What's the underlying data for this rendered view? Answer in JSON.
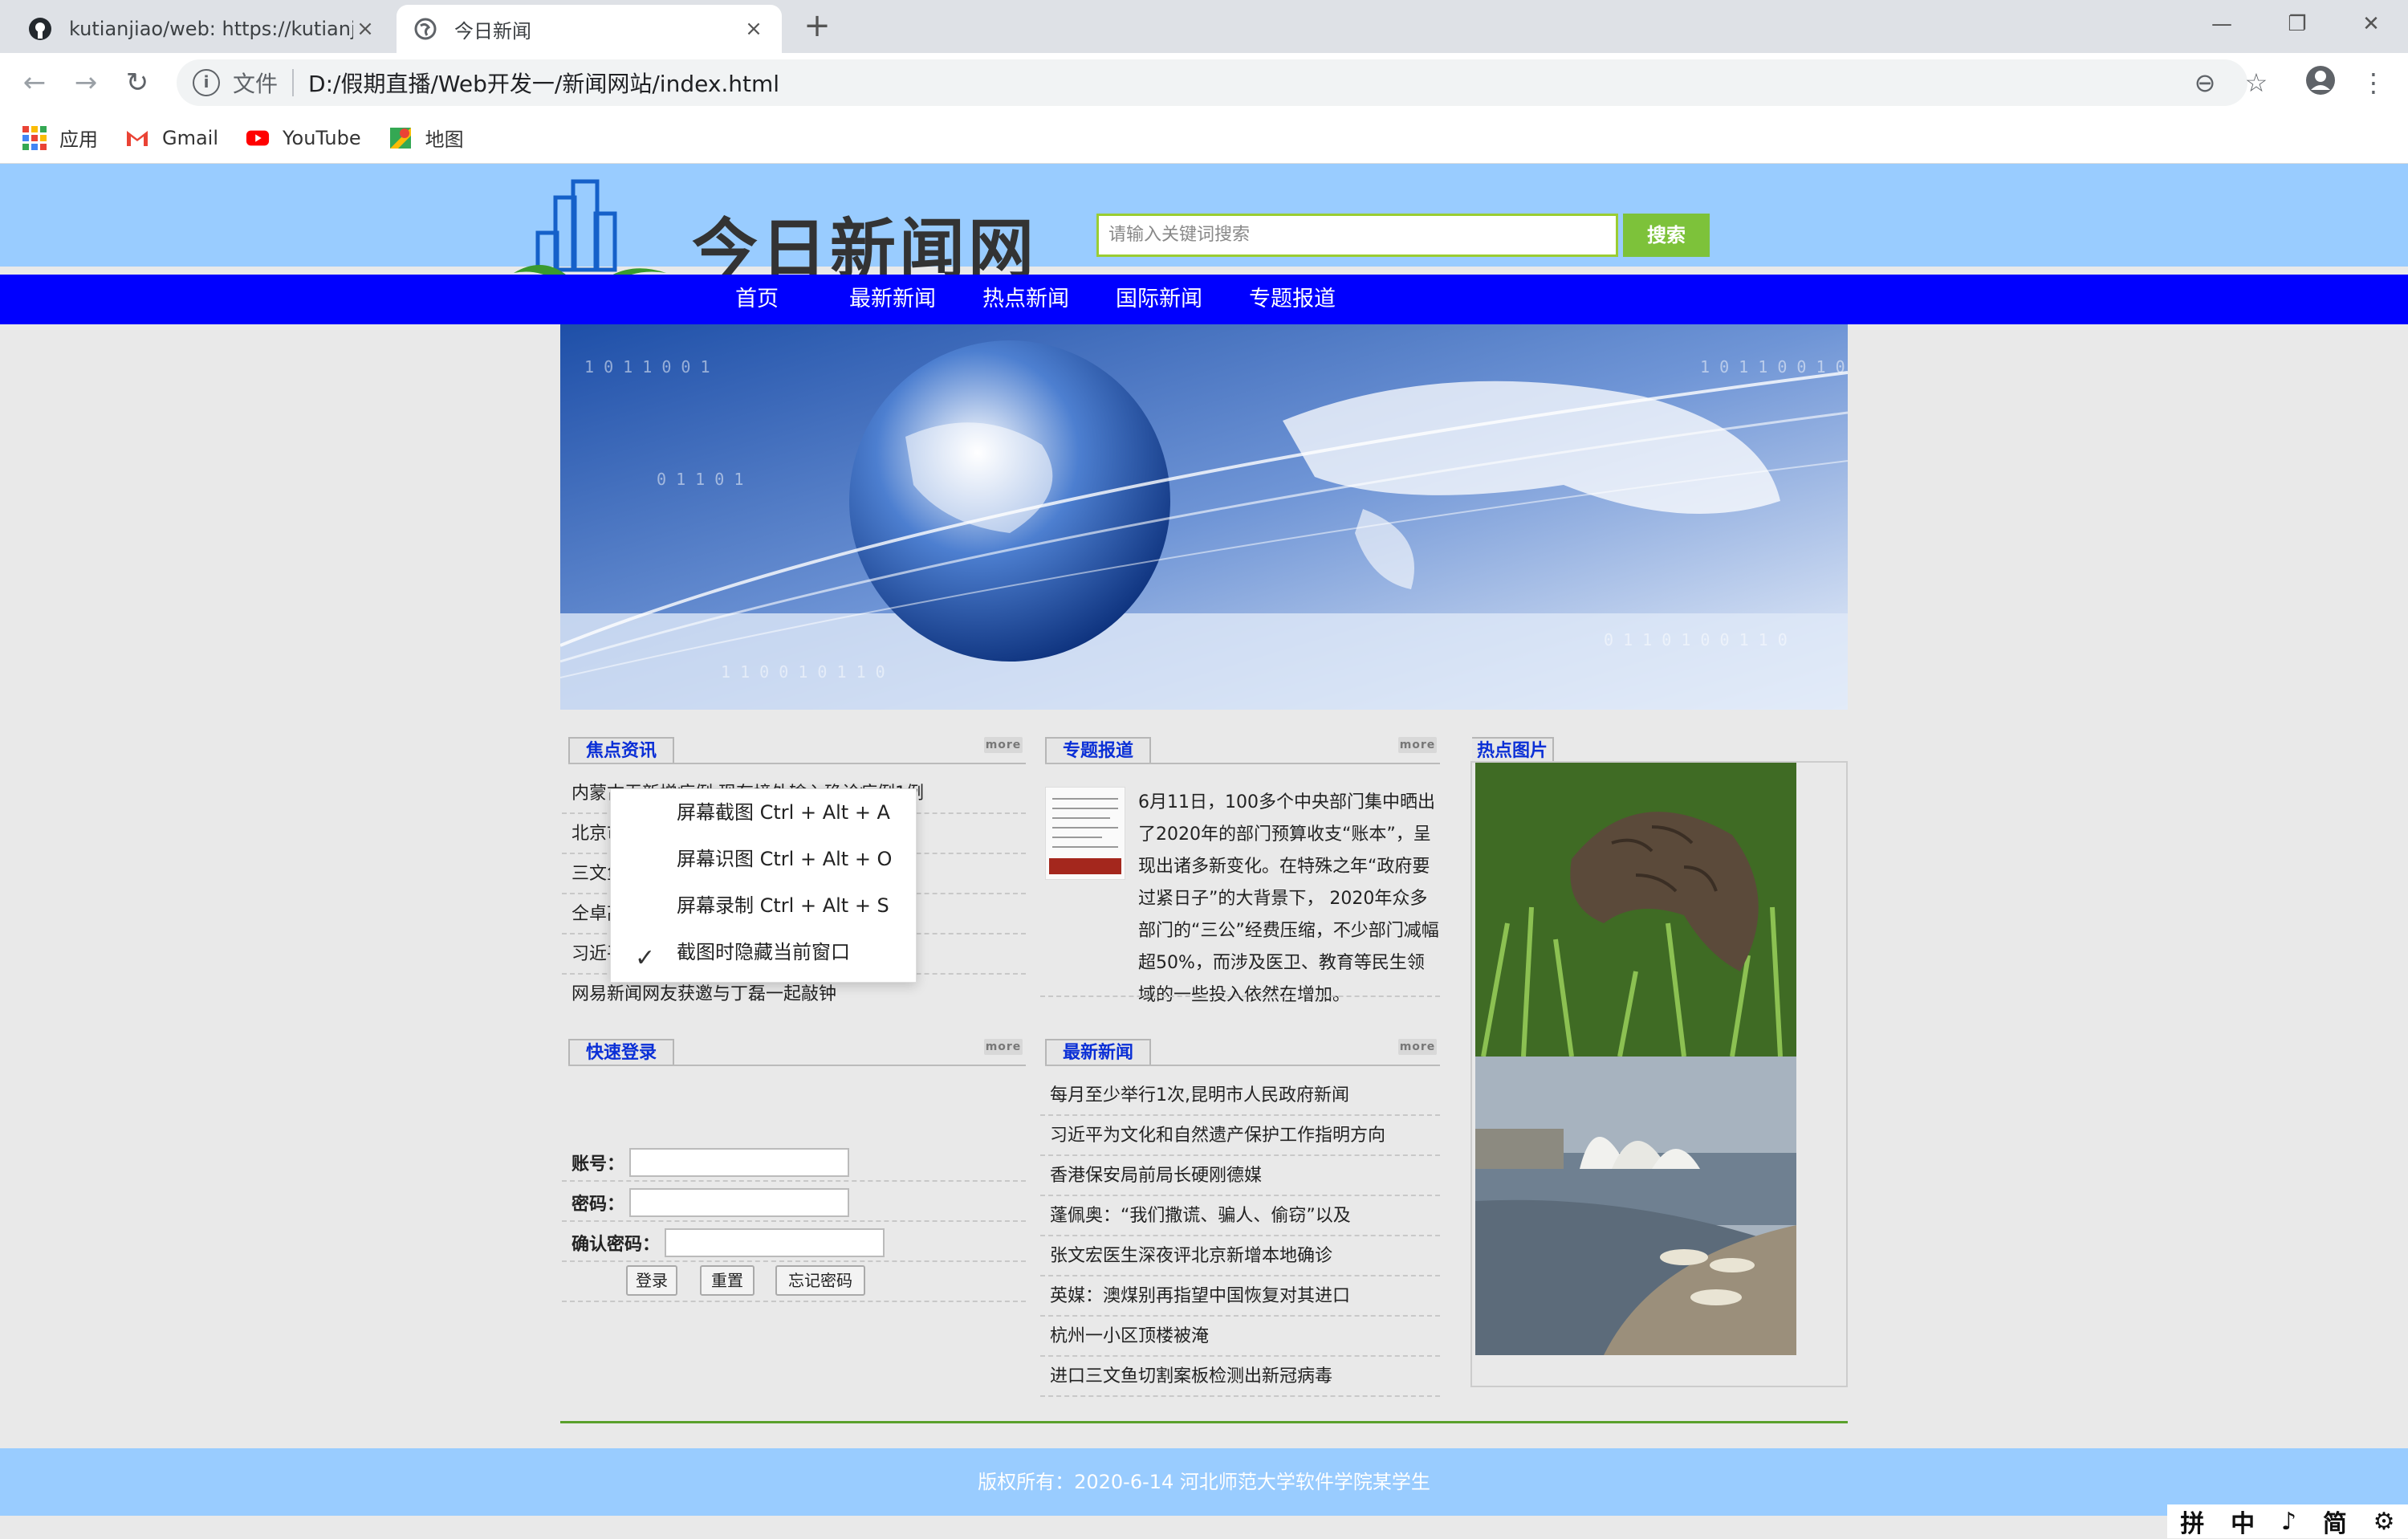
{
  "browser": {
    "tabs": [
      {
        "title": "kutianjiao/web: https://kutianj",
        "close": "×"
      },
      {
        "title": "今日新闻",
        "close": "×"
      }
    ],
    "new_tab": "+",
    "window": {
      "minimize": "—",
      "maximize": "❐",
      "close": "✕"
    },
    "address": {
      "scheme_label": "文件",
      "url": "D:/假期直播/Web开发一/新闻网站/index.html"
    },
    "bookmarks": [
      {
        "label": "应用",
        "icon": "apps-grid-icon"
      },
      {
        "label": "Gmail",
        "icon": "gmail-icon"
      },
      {
        "label": "YouTube",
        "icon": "youtube-icon"
      },
      {
        "label": "地图",
        "icon": "maps-icon"
      }
    ]
  },
  "site": {
    "logo_text": "今日新闻网",
    "search": {
      "placeholder": "请输入关键词搜索",
      "button": "搜索"
    },
    "nav": [
      "首页",
      "最新新闻",
      "热点新闻",
      "国际新闻",
      "专题报道"
    ]
  },
  "focus_news": {
    "title": "焦点资讯",
    "more": "more",
    "items": [
      "内蒙古无新增病例 现有境外输入确诊病例1例",
      "北京市近日连续新增病例",
      "三文鱼或成传播源头",
      "仝卓高考成绩作废",
      "习近平",
      "网易新闻网友获邀与丁磊一起敲钟"
    ]
  },
  "context_menu": {
    "items": [
      "屏幕截图 Ctrl + Alt + A",
      "屏幕识图 Ctrl + Alt + O",
      "屏幕录制 Ctrl + Alt + S",
      "截图时隐藏当前窗口"
    ],
    "checked_index": 3
  },
  "feature": {
    "title": "专题报道",
    "more": "more",
    "text": "6月11日，100多个中央部门集中晒出了2020年的部门预算收支“账本”，呈现出诸多新变化。在特殊之年“政府要过紧日子”的大背景下， 2020年众多部门的“三公”经费压缩，不少部门减幅超50%，而涉及医卫、教育等民生领域的一些投入依然在增加。"
  },
  "hot_pictures": {
    "title": "热点图片"
  },
  "login": {
    "title": "快速登录",
    "more": "more",
    "account_label": "账号：",
    "password_label": "密码：",
    "confirm_label": "确认密码：",
    "buttons": [
      "登录",
      "重置",
      "忘记密码"
    ]
  },
  "latest_news": {
    "title": "最新新闻",
    "more": "more",
    "items": [
      "每月至少举行1次,昆明市人民政府新闻",
      "习近平为文化和自然遗产保护工作指明方向",
      "香港保安局前局长硬刚德媒",
      "蓬佩奥：“我们撒谎、骗人、偷窃”以及",
      "张文宏医生深夜评北京新增本地确诊",
      "英媒：澳煤别再指望中国恢复对其进口",
      "杭州一小区顶楼被淹",
      "进口三文鱼切割案板检测出新冠病毒"
    ]
  },
  "footer": {
    "text": "版权所有：2020-6-14 河北师范大学软件学院某学生"
  },
  "ime_bar": {
    "glyphs": [
      "拼",
      "中",
      "♪",
      "简",
      "⚙"
    ]
  },
  "colors": {
    "header_bg": "#99ccff",
    "nav_bg": "#0000ff",
    "search_button": "#7dc23a",
    "section_title": "#0a2fd6"
  }
}
